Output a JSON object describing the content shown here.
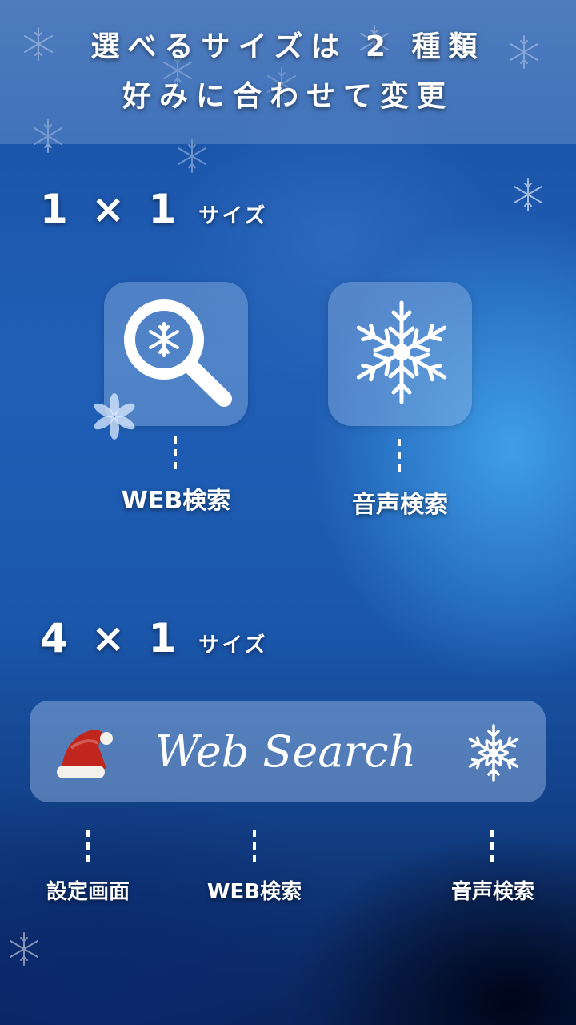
{
  "header": {
    "line1": "選べるサイズは 2 種類",
    "line2": "好みに合わせて変更"
  },
  "section_1x1": {
    "size": "1 × 1",
    "suffix": "サイズ",
    "tiles": [
      {
        "caption": "WEB検索",
        "icon": "magnifier-snowflake-icon"
      },
      {
        "caption": "音声検索",
        "icon": "snowflake-icon"
      }
    ]
  },
  "section_4x1": {
    "size": "4 × 1",
    "suffix": "サイズ",
    "widget_title": "Web Search",
    "left_icon": "santa-hat-icon",
    "right_icon": "snowflake-icon",
    "captions": [
      "設定画面",
      "WEB検索",
      "音声検索"
    ]
  },
  "colors": {
    "background_top": "#1a4fa3",
    "background_bottom": "#0a2358",
    "tile": "#a0bee6",
    "text": "#ffffff",
    "hat_red": "#c0261e"
  }
}
